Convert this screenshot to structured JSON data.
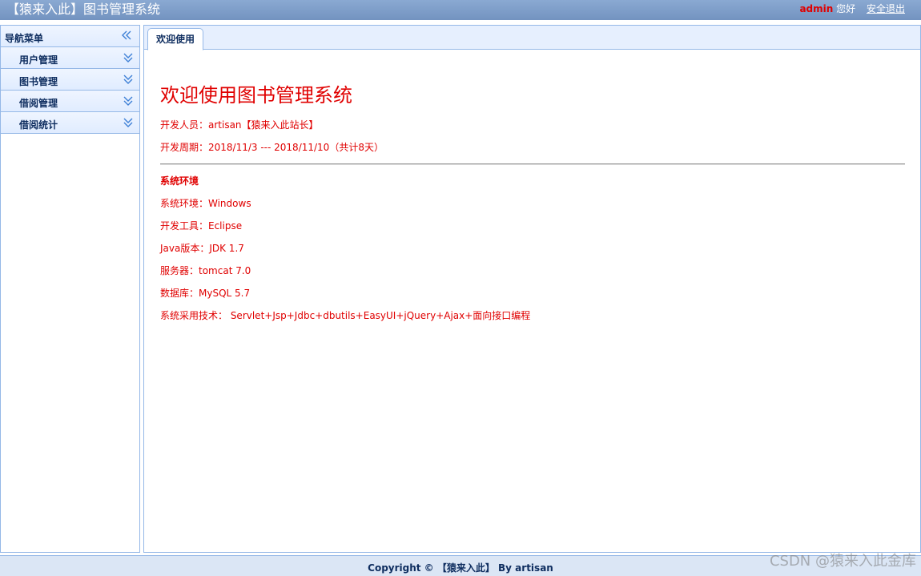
{
  "header": {
    "title": "【猿来入此】图书管理系统",
    "username": "admin",
    "greeting": "您好",
    "logout_label": "安全退出"
  },
  "nav": {
    "title": "导航菜单",
    "items": [
      {
        "label": "用户管理"
      },
      {
        "label": "图书管理"
      },
      {
        "label": "借阅管理"
      },
      {
        "label": "借阅统计"
      }
    ]
  },
  "tabs": [
    {
      "label": "欢迎使用"
    }
  ],
  "content": {
    "title": "欢迎使用图书管理系统",
    "developer": "开发人员：artisan【猿来入此站长】",
    "period": "开发周期：2018/11/3 --- 2018/11/10（共计8天）",
    "section_title": "系统环境",
    "env_lines": [
      "系统环境：Windows",
      "开发工具：Eclipse",
      "Java版本：JDK 1.7",
      "服务器：tomcat 7.0",
      "数据库：MySQL 5.7",
      "系统采用技术： Servlet+Jsp+Jdbc+dbutils+EasyUI+jQuery+Ajax+面向接口编程"
    ]
  },
  "footer": {
    "text": "Copyright © 【猿来入此】 By artisan"
  },
  "watermark": "CSDN @猿来入此金库",
  "colors": {
    "header_bg": "#7a9cc8",
    "accent_red": "#e00000",
    "panel_border": "#95b8e7",
    "nav_text": "#0e2d5f"
  }
}
